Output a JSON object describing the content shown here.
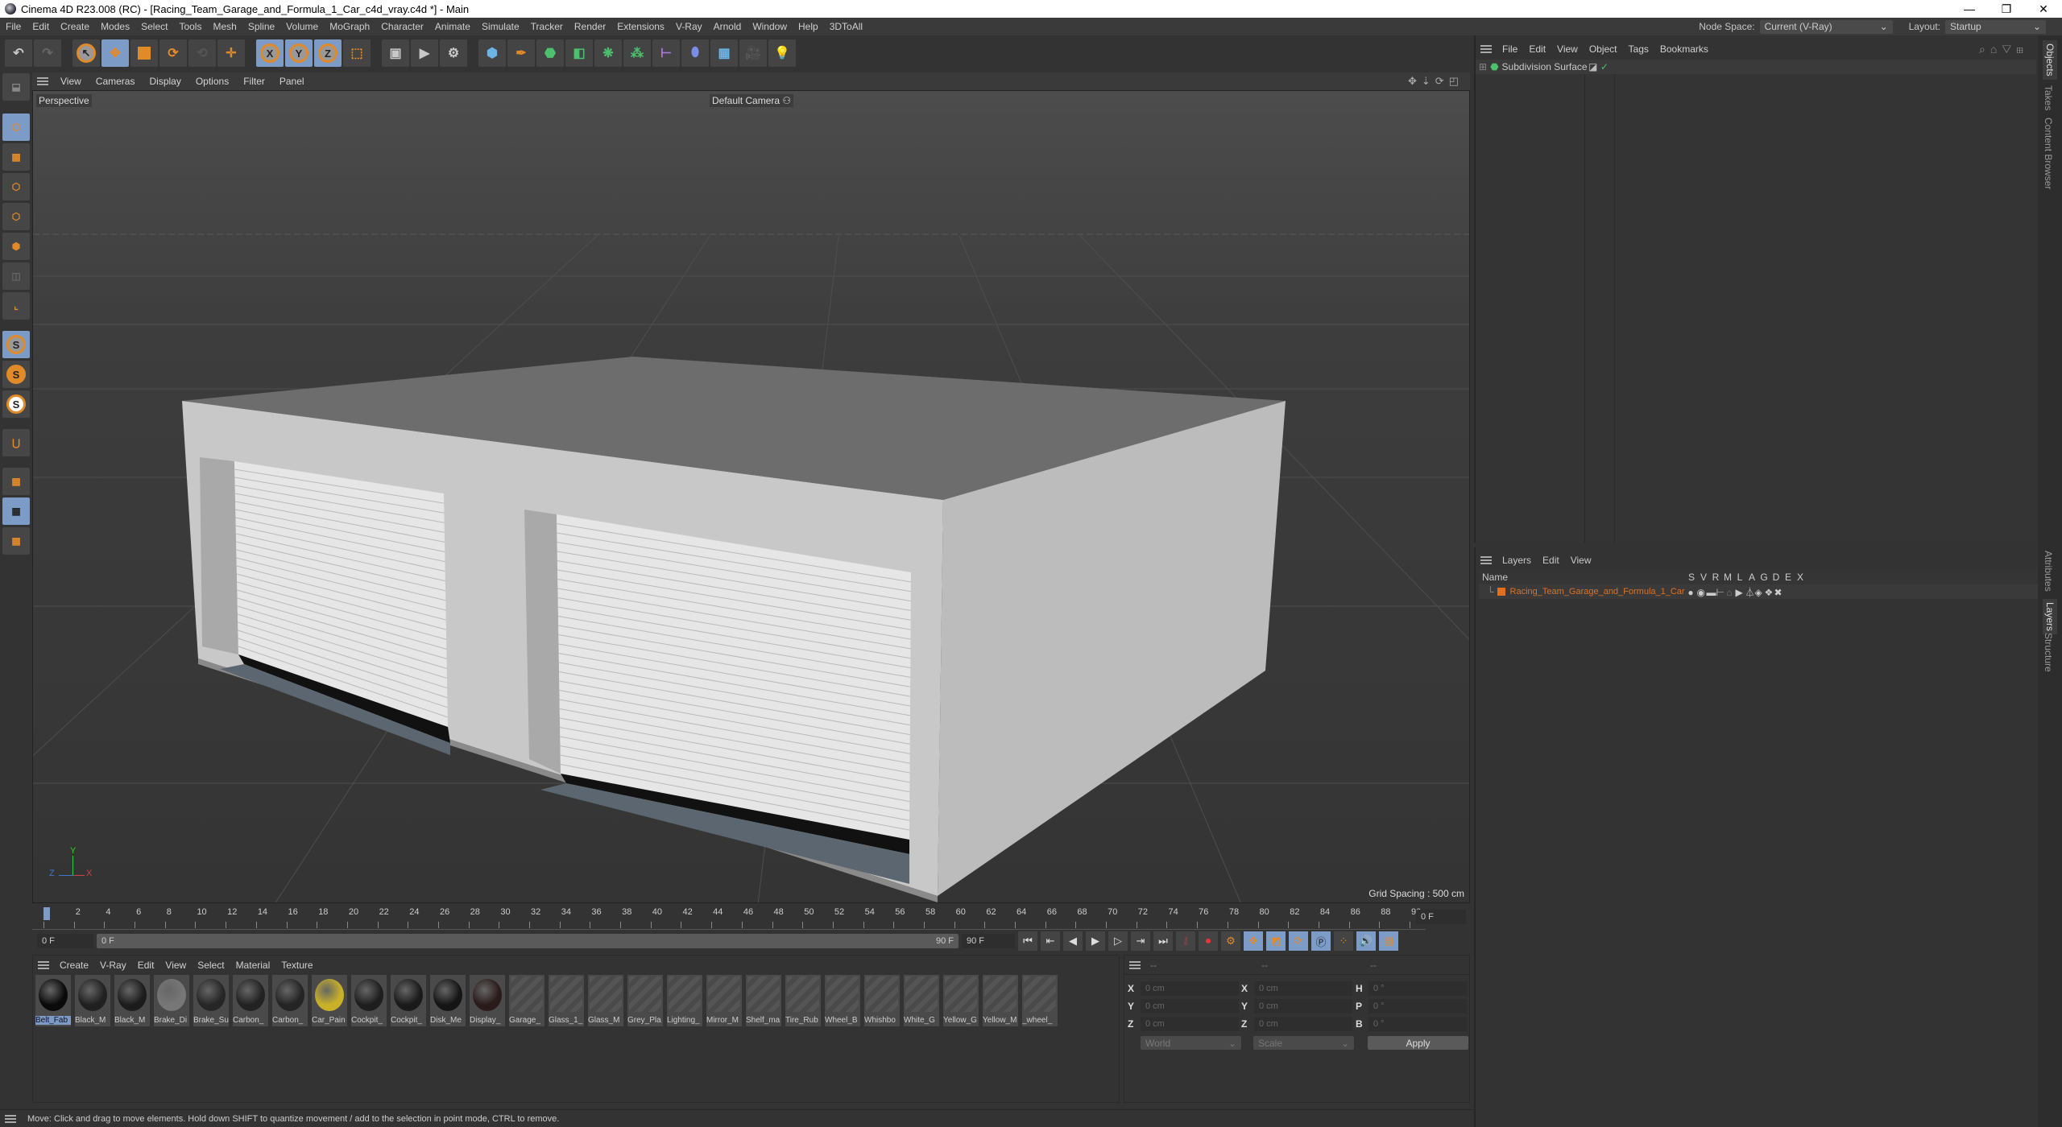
{
  "window": {
    "title": "Cinema 4D R23.008 (RC) - [Racing_Team_Garage_and_Formula_1_Car_c4d_vray.c4d *] - Main",
    "minimize": "—",
    "maximize": "❐",
    "close": "✕"
  },
  "menubar": {
    "items": [
      "File",
      "Edit",
      "Create",
      "Modes",
      "Select",
      "Tools",
      "Mesh",
      "Spline",
      "Volume",
      "MoGraph",
      "Character",
      "Animate",
      "Simulate",
      "Tracker",
      "Render",
      "Extensions",
      "V-Ray",
      "Arnold",
      "Window",
      "Help",
      "3DToAll"
    ],
    "node_space_label": "Node Space:",
    "node_space_value": "Current (V-Ray)",
    "layout_label": "Layout:",
    "layout_value": "Startup"
  },
  "toolbar": {
    "axis": [
      "X",
      "Y",
      "Z"
    ]
  },
  "viewport": {
    "menu": [
      "View",
      "Cameras",
      "Display",
      "Options",
      "Filter",
      "Panel"
    ],
    "label": "Perspective",
    "camera": "Default Camera",
    "grid_spacing": "Grid Spacing : 500 cm",
    "axis": {
      "x": "X",
      "y": "Y",
      "z": "Z"
    }
  },
  "timeline": {
    "ticks": [
      "0",
      "2",
      "4",
      "6",
      "8",
      "10",
      "12",
      "14",
      "16",
      "18",
      "20",
      "22",
      "24",
      "26",
      "28",
      "30",
      "32",
      "34",
      "36",
      "38",
      "40",
      "42",
      "44",
      "46",
      "48",
      "50",
      "52",
      "54",
      "56",
      "58",
      "60",
      "62",
      "64",
      "66",
      "68",
      "70",
      "72",
      "74",
      "76",
      "78",
      "80",
      "82",
      "84",
      "86",
      "88",
      "90"
    ],
    "current_frame": "0 F",
    "start": "0 F",
    "range_start": "0 F",
    "range_end": "90 F",
    "end": "90 F"
  },
  "materials": {
    "menu": [
      "Create",
      "V-Ray",
      "Edit",
      "View",
      "Select",
      "Material",
      "Texture"
    ],
    "items": [
      {
        "name": "Belt_Fab",
        "color": "#0a0a0a",
        "selected": true
      },
      {
        "name": "Black_M",
        "color": "#202020"
      },
      {
        "name": "Black_M",
        "color": "#1c1c1c"
      },
      {
        "name": "Brake_Di",
        "color": "#777"
      },
      {
        "name": "Brake_Su",
        "color": "#262626"
      },
      {
        "name": "Carbon_",
        "color": "#222"
      },
      {
        "name": "Carbon_",
        "color": "#242424"
      },
      {
        "name": "Car_Pain",
        "color": "#c9b127"
      },
      {
        "name": "Cockpit_",
        "color": "#1e1e1e"
      },
      {
        "name": "Cockpit_",
        "color": "#1a1a1a"
      },
      {
        "name": "Disk_Me",
        "color": "#151515"
      },
      {
        "name": "Display_",
        "color": "#2a1a1a"
      },
      {
        "name": "Garage_",
        "stripe": true
      },
      {
        "name": "Glass_1_",
        "stripe": true
      },
      {
        "name": "Glass_M",
        "stripe": true
      },
      {
        "name": "Grey_Pla",
        "stripe": true
      },
      {
        "name": "Lighting_",
        "stripe": true
      },
      {
        "name": "Mirror_M",
        "stripe": true
      },
      {
        "name": "Shelf_ma",
        "stripe": true
      },
      {
        "name": "Tire_Rub",
        "stripe": true
      },
      {
        "name": "Wheel_B",
        "stripe": true
      },
      {
        "name": "Whishbo",
        "stripe": true
      },
      {
        "name": "White_G",
        "stripe": true
      },
      {
        "name": "Yellow_G",
        "stripe": true
      },
      {
        "name": "Yellow_M",
        "stripe": true
      },
      {
        "name": "_wheel_",
        "stripe": true
      }
    ]
  },
  "coordinates": {
    "headers": [
      "--",
      "--",
      "--"
    ],
    "position": [
      {
        "label": "X",
        "value": "0 cm"
      },
      {
        "label": "Y",
        "value": "0 cm"
      },
      {
        "label": "Z",
        "value": "0 cm"
      }
    ],
    "size": [
      {
        "label": "X",
        "value": "0 cm"
      },
      {
        "label": "Y",
        "value": "0 cm"
      },
      {
        "label": "Z",
        "value": "0 cm"
      }
    ],
    "rotation": [
      {
        "label": "H",
        "value": "0 °"
      },
      {
        "label": "P",
        "value": "0 °"
      },
      {
        "label": "B",
        "value": "0 °"
      }
    ],
    "space": "World",
    "mode": "Scale",
    "apply": "Apply"
  },
  "objects": {
    "menu": [
      "File",
      "Edit",
      "View",
      "Object",
      "Tags",
      "Bookmarks"
    ],
    "items": [
      {
        "name": "Subdivision Surface"
      }
    ]
  },
  "layers": {
    "menu": [
      "Layers",
      "Edit",
      "View"
    ],
    "name_header": "Name",
    "columns": [
      "S",
      "V",
      "R",
      "M",
      "L",
      "A",
      "G",
      "D",
      "E",
      "X"
    ],
    "items": [
      {
        "name": "Racing_Team_Garage_and_Formula_1_Car",
        "color": "#e07020"
      }
    ]
  },
  "side_tabs": {
    "top": [
      "Objects",
      "Takes",
      "Content Browser"
    ],
    "bottom": [
      "Attributes",
      "Layers",
      "Structure"
    ]
  },
  "status": "Move: Click and drag to move elements. Hold down SHIFT to quantize movement / add to the selection in point mode, CTRL to remove."
}
